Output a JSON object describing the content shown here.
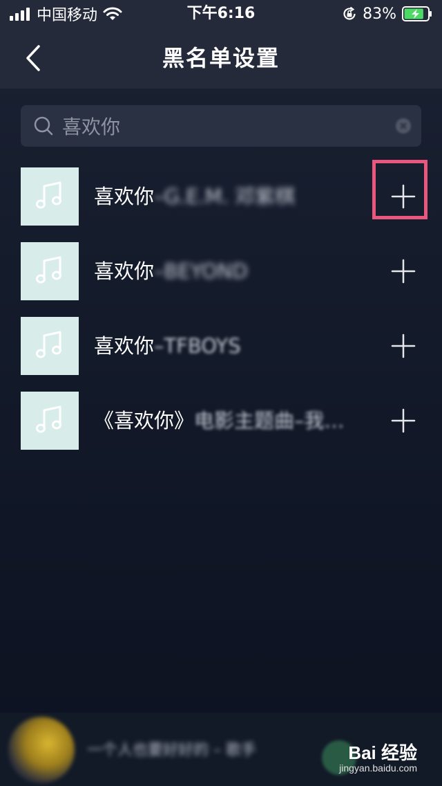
{
  "status_bar": {
    "carrier": "中国移动",
    "time": "下午6:16",
    "battery_percent": "83%",
    "battery_level": 0.83,
    "icons": [
      "signal-icon",
      "wifi-icon",
      "rotation-lock-icon",
      "battery-charging-icon"
    ]
  },
  "nav": {
    "title": "黑名单设置",
    "back_icon": "chevron-left-icon"
  },
  "search": {
    "value": "喜欢你",
    "icon": "search-icon",
    "clear_icon": "clear-icon"
  },
  "songs": [
    {
      "title": "喜欢你",
      "rest": "–G.E.M. 邓紫棋",
      "icon": "music-note-icon",
      "action_icon": "plus-icon"
    },
    {
      "title": "喜欢你",
      "rest": "–BEYOND",
      "icon": "music-note-icon",
      "action_icon": "plus-icon"
    },
    {
      "title": "喜欢你",
      "rest": "–TFBOYS",
      "icon": "music-note-icon",
      "action_icon": "plus-icon"
    },
    {
      "title": "《喜欢你》",
      "rest": "电影主题曲–我…",
      "icon": "music-note-icon",
      "action_icon": "plus-icon"
    }
  ],
  "mini_player": {
    "text": "一个人也要好好的 – 歌手",
    "play_icon": "play-icon"
  },
  "watermark": {
    "main": "Bai 经验",
    "sub": "jingyan.baidu.com"
  },
  "colors": {
    "bar_bg": "#242a3a",
    "page_bg": "#151c2c",
    "cover_bg": "#d8ece9",
    "highlight": "#e9577e",
    "battery_green": "#4cd964"
  }
}
